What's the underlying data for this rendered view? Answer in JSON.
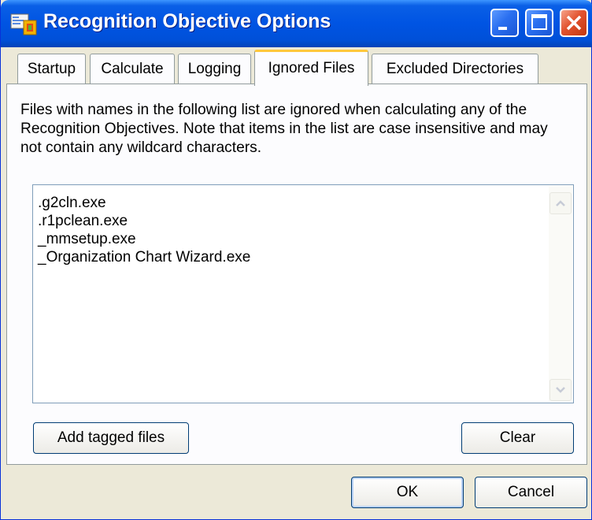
{
  "window": {
    "title": "Recognition Objective Options",
    "colors": {
      "titlebar": "#0054e3",
      "face": "#ece9d8",
      "active_tab_accent": "#ffc83c",
      "close": "#e2532f"
    }
  },
  "tabs": [
    {
      "label": "Startup",
      "active": false
    },
    {
      "label": "Calculate",
      "active": false
    },
    {
      "label": "Logging",
      "active": false
    },
    {
      "label": "Ignored Files",
      "active": true
    },
    {
      "label": "Excluded Directories",
      "active": false
    }
  ],
  "panel": {
    "description": "Files with names in the following list are ignored when calculating any of the Recognition Objectives. Note that items in the list are case insensitive and may not contain any wildcard characters.",
    "list_items": [
      ".g2cln.exe",
      ".r1pclean.exe",
      "_mmsetup.exe",
      "_Organization Chart Wizard.exe"
    ],
    "add_tagged_label": "Add tagged files",
    "clear_label": "Clear"
  },
  "footer": {
    "ok_label": "OK",
    "cancel_label": "Cancel"
  },
  "icons": {
    "app": "options-app-icon",
    "minimize": "minimize-icon",
    "maximize": "maximize-icon",
    "close": "close-icon",
    "scroll_up": "scroll-up-arrow-icon",
    "scroll_down": "scroll-down-arrow-icon"
  }
}
